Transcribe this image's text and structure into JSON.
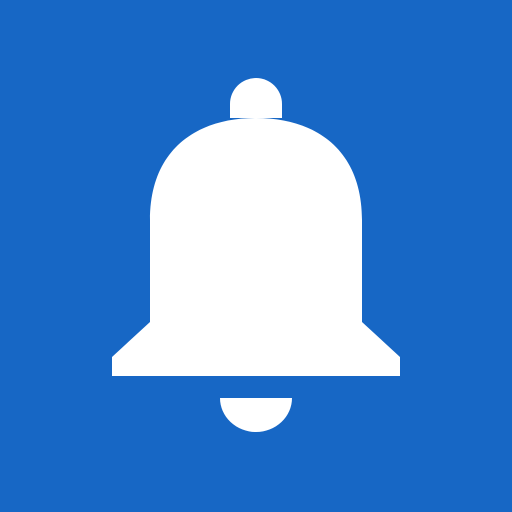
{
  "icon": {
    "name": "bell-icon",
    "background_color": "#1767C5",
    "foreground_color": "#FFFFFF"
  }
}
